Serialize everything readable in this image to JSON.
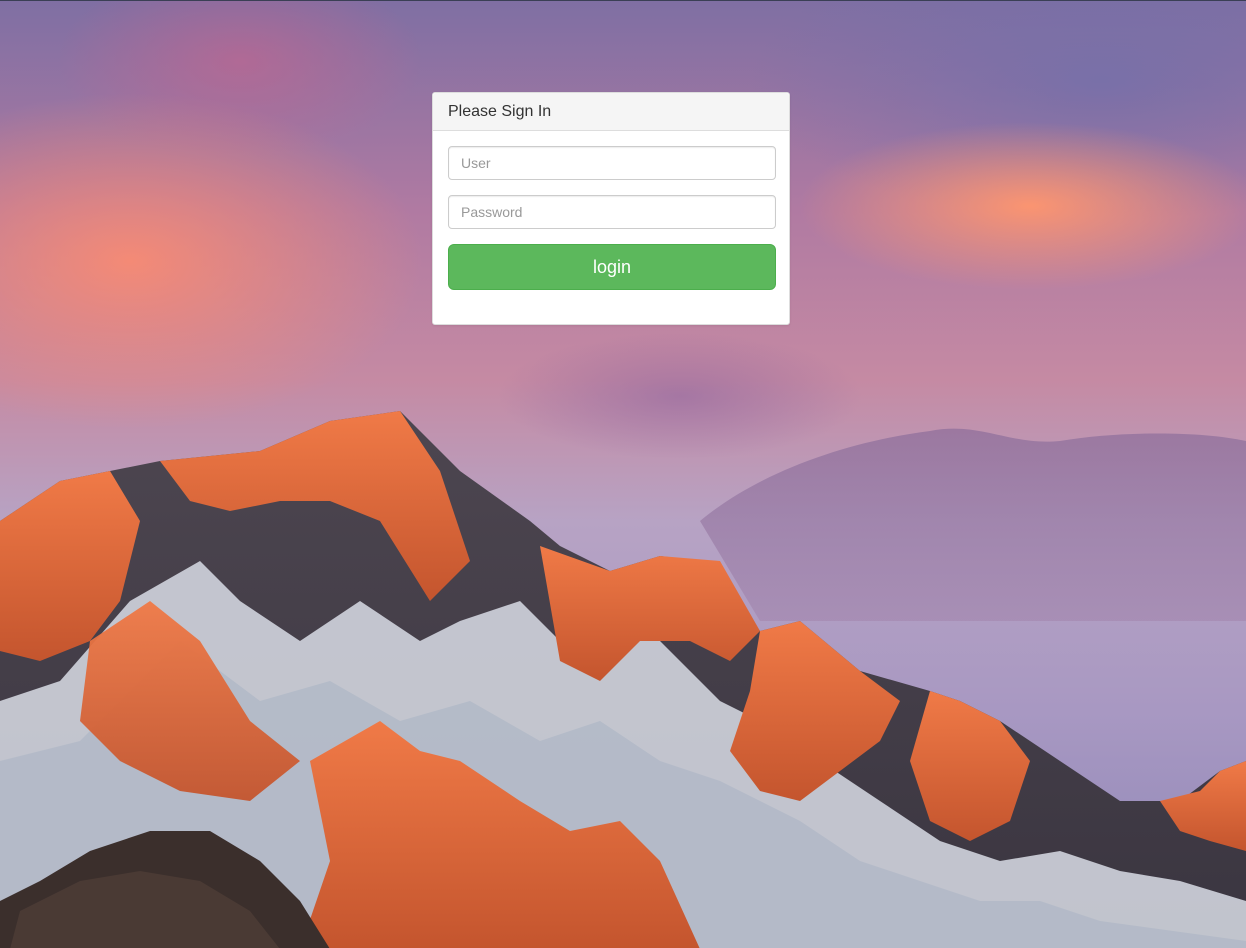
{
  "login_panel": {
    "title": "Please Sign In",
    "user_field": {
      "placeholder": "User",
      "value": ""
    },
    "password_field": {
      "placeholder": "Password",
      "value": ""
    },
    "login_button_label": "login",
    "button_color": "#5cb85c"
  },
  "background": {
    "description_icon": "mountain-sunset-wallpaper"
  }
}
